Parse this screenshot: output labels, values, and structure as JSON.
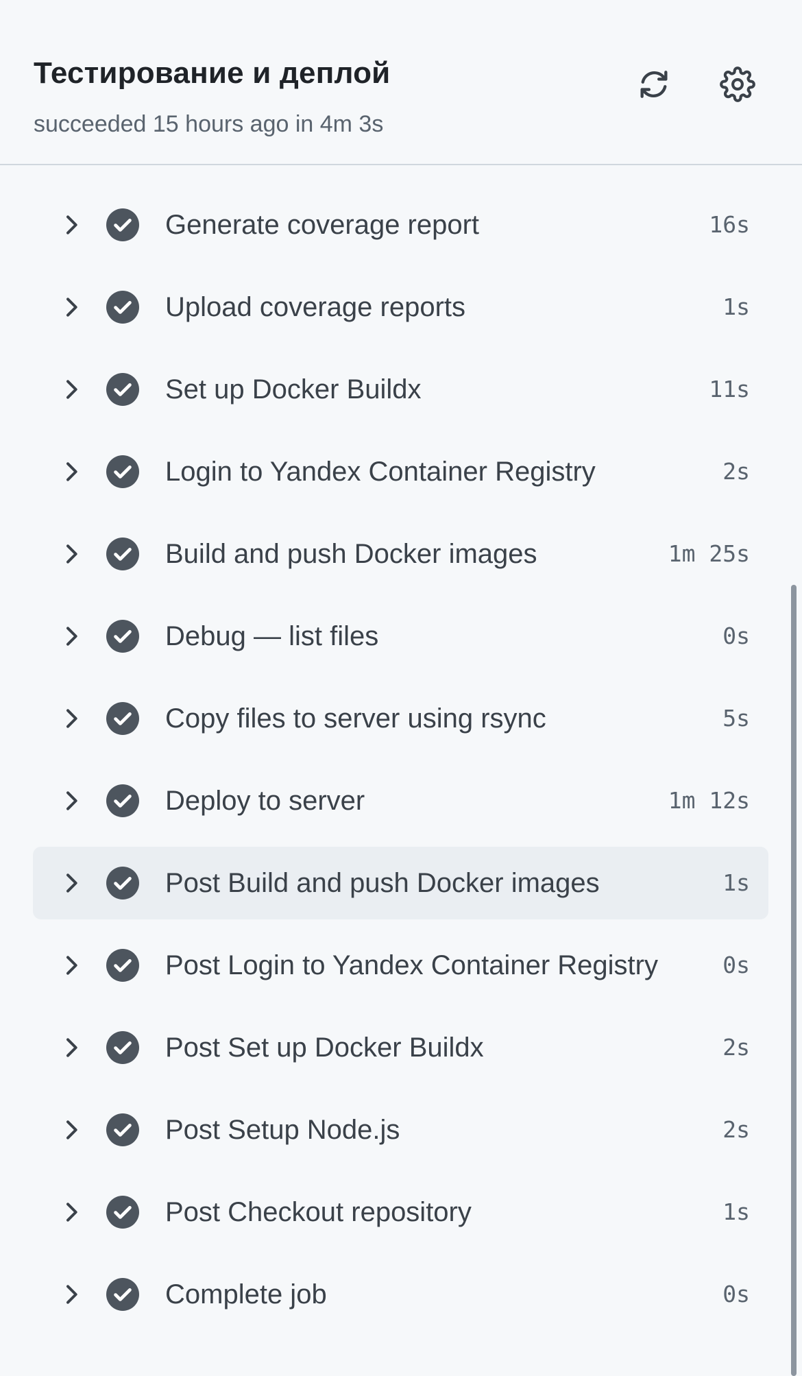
{
  "header": {
    "title": "Тестирование и деплой",
    "status": "succeeded 15 hours ago in 4m 3s",
    "refresh_icon": "refresh-icon",
    "settings_icon": "gear-icon"
  },
  "colors": {
    "background": "#f6f8fa",
    "success_icon": "#4d555e",
    "highlight_row": "#eaeef2",
    "muted_text": "#59636e"
  },
  "steps": [
    {
      "name": "Generate coverage report",
      "duration": "16s",
      "status_icon": "check-circle-icon"
    },
    {
      "name": "Upload coverage reports",
      "duration": "1s",
      "status_icon": "check-circle-icon"
    },
    {
      "name": "Set up Docker Buildx",
      "duration": "11s",
      "status_icon": "check-circle-icon"
    },
    {
      "name": "Login to Yandex Container Registry",
      "duration": "2s",
      "status_icon": "check-circle-icon"
    },
    {
      "name": "Build and push Docker images",
      "duration": "1m 25s",
      "status_icon": "check-circle-icon"
    },
    {
      "name": "Debug — list files",
      "duration": "0s",
      "status_icon": "check-circle-icon"
    },
    {
      "name": "Copy files to server using rsync",
      "duration": "5s",
      "status_icon": "check-circle-icon"
    },
    {
      "name": "Deploy to server",
      "duration": "1m 12s",
      "status_icon": "check-circle-icon"
    },
    {
      "name": "Post Build and push Docker images",
      "duration": "1s",
      "status_icon": "check-circle-icon",
      "highlighted": true
    },
    {
      "name": "Post Login to Yandex Container Registry",
      "duration": "0s",
      "status_icon": "check-circle-icon"
    },
    {
      "name": "Post Set up Docker Buildx",
      "duration": "2s",
      "status_icon": "check-circle-icon"
    },
    {
      "name": "Post Setup Node.js",
      "duration": "2s",
      "status_icon": "check-circle-icon"
    },
    {
      "name": "Post Checkout repository",
      "duration": "1s",
      "status_icon": "check-circle-icon"
    },
    {
      "name": "Complete job",
      "duration": "0s",
      "status_icon": "check-circle-icon"
    }
  ]
}
